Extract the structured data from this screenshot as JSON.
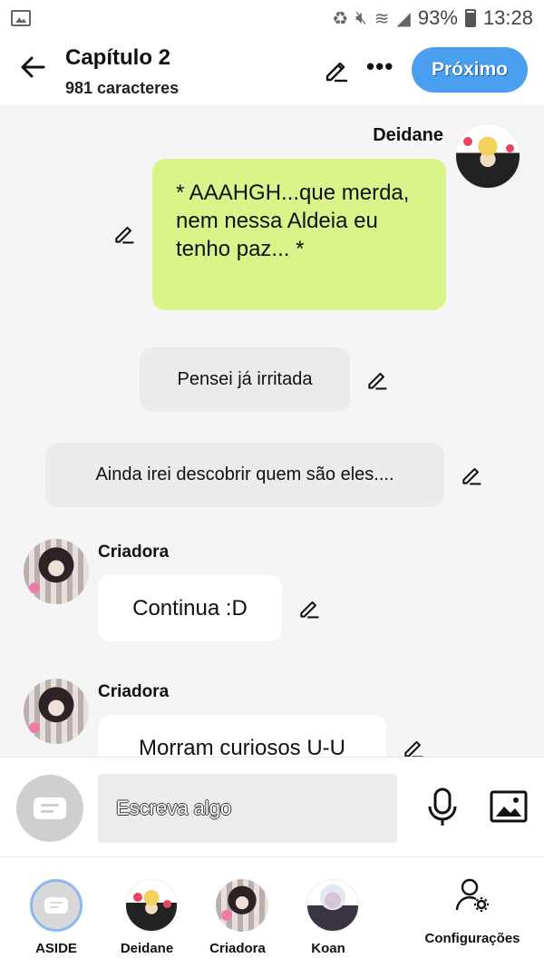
{
  "statusbar": {
    "battery_pct": "93%",
    "time": "13:28"
  },
  "header": {
    "title": "Capítulo 2",
    "subtitle": "981 caracteres",
    "next_label": "Próximo"
  },
  "messages": [
    {
      "type": "character",
      "side": "right",
      "speaker": "Deidane",
      "text": "* AAAHGH...que merda, nem nessa Aldeia eu tenho paz... *",
      "bubble_color": "#d9f58a"
    },
    {
      "type": "aside",
      "text": "Pensei já irritada"
    },
    {
      "type": "aside",
      "text": "Ainda irei descobrir quem são eles...."
    },
    {
      "type": "character",
      "side": "left",
      "speaker": "Criadora",
      "text": "Continua :D"
    },
    {
      "type": "character",
      "side": "left",
      "speaker": "Criadora",
      "text": "Morram curiosos U-U"
    }
  ],
  "composer": {
    "placeholder": "Escreva algo"
  },
  "characters": [
    {
      "name": "ASIDE",
      "selected": true
    },
    {
      "name": "Deidane"
    },
    {
      "name": "Criadora"
    },
    {
      "name": "Koan"
    }
  ],
  "settings_label": "Configurações",
  "colors": {
    "accent": "#4a9ff0",
    "deidane_bubble": "#d9f58a",
    "aside_bubble": "#ebebeb"
  }
}
